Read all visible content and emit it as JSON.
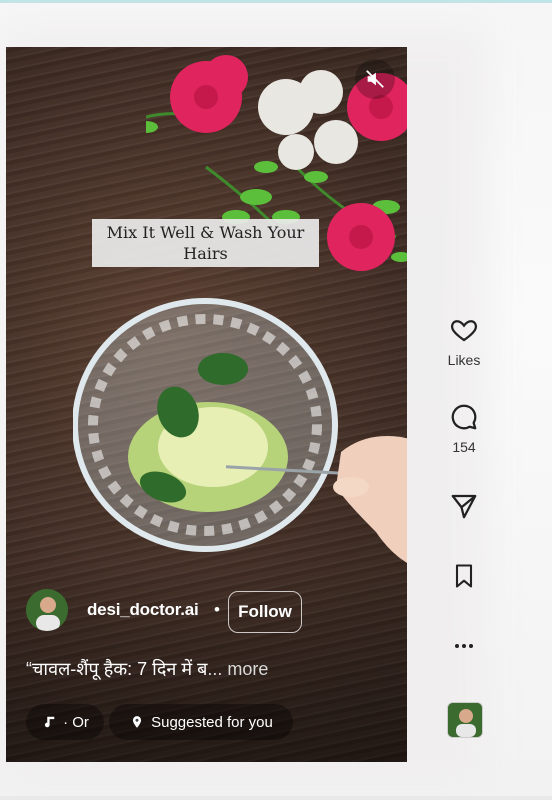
{
  "reel": {
    "overlay_text": "Mix It Well & Wash Your Hairs",
    "username": "desi_doctor.ai",
    "separator": "•",
    "follow_label": "Follow",
    "caption": "“चावल-शैंपू हैक: 7 दिन में ब",
    "caption_more": "... more",
    "audio_label": "· Or",
    "suggested_label": "Suggested for you"
  },
  "actions": {
    "likes_label": "Likes",
    "comments_count": "154"
  },
  "icons": {
    "mute": "muted-speaker-icon",
    "like": "heart-icon",
    "comment": "comment-icon",
    "share": "send-icon",
    "save": "bookmark-icon",
    "more": "more-dots-icon",
    "audio": "music-note-icon",
    "location": "location-pin-icon"
  }
}
